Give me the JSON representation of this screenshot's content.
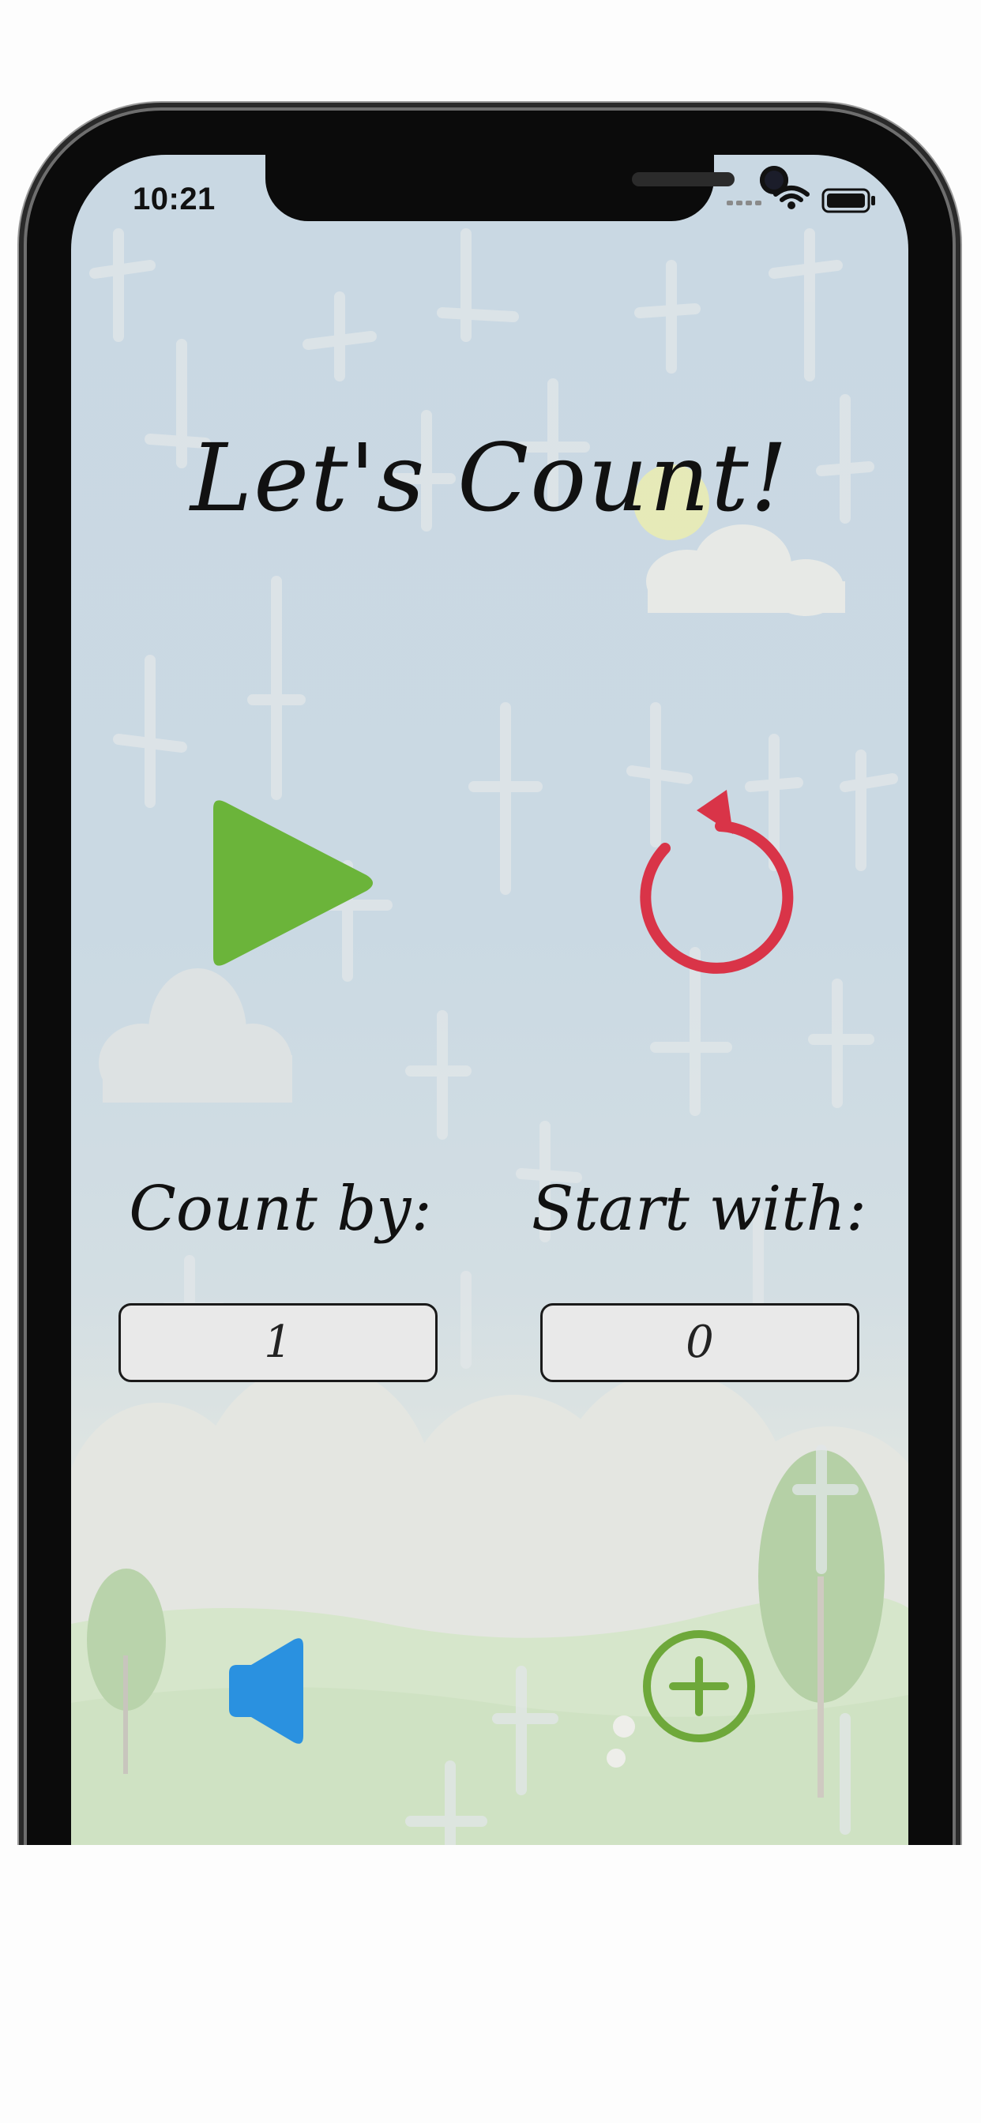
{
  "status_bar": {
    "time": "10:21"
  },
  "app": {
    "title": "Let's Count!"
  },
  "controls": {
    "play_icon": "play-icon",
    "reset_icon": "reset-icon",
    "sound_icon": "speaker-icon",
    "add_icon": "plus-circle-icon"
  },
  "fields": {
    "count_by_label": "Count by:",
    "count_by_value": "1",
    "start_with_label": "Start with:",
    "start_with_value": "0"
  },
  "colors": {
    "play": "#6bb43a",
    "reset": "#d93448",
    "sound": "#2a91e0",
    "add": "#6ea83a"
  }
}
